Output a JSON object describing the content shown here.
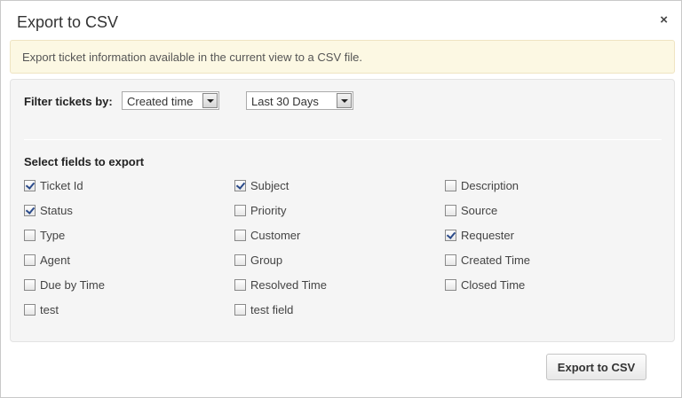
{
  "dialog": {
    "title": "Export to CSV",
    "close_glyph": "×"
  },
  "notice": {
    "text": "Export ticket information available in the current view to a CSV file."
  },
  "filter": {
    "label": "Filter tickets by:",
    "field_select": "Created time",
    "range_select": "Last 30 Days"
  },
  "fields_section": {
    "title": "Select fields to export",
    "fields": [
      {
        "label": "Ticket Id",
        "checked": true
      },
      {
        "label": "Subject",
        "checked": true
      },
      {
        "label": "Description",
        "checked": false
      },
      {
        "label": "Status",
        "checked": true
      },
      {
        "label": "Priority",
        "checked": false
      },
      {
        "label": "Source",
        "checked": false
      },
      {
        "label": "Type",
        "checked": false
      },
      {
        "label": "Customer",
        "checked": false
      },
      {
        "label": "Requester",
        "checked": true
      },
      {
        "label": "Agent",
        "checked": false
      },
      {
        "label": "Group",
        "checked": false
      },
      {
        "label": "Created Time",
        "checked": false
      },
      {
        "label": "Due by Time",
        "checked": false
      },
      {
        "label": "Resolved Time",
        "checked": false
      },
      {
        "label": "Closed Time",
        "checked": false
      },
      {
        "label": "test",
        "checked": false
      },
      {
        "label": "test field",
        "checked": false
      }
    ]
  },
  "footer": {
    "export_button": "Export to CSV"
  }
}
